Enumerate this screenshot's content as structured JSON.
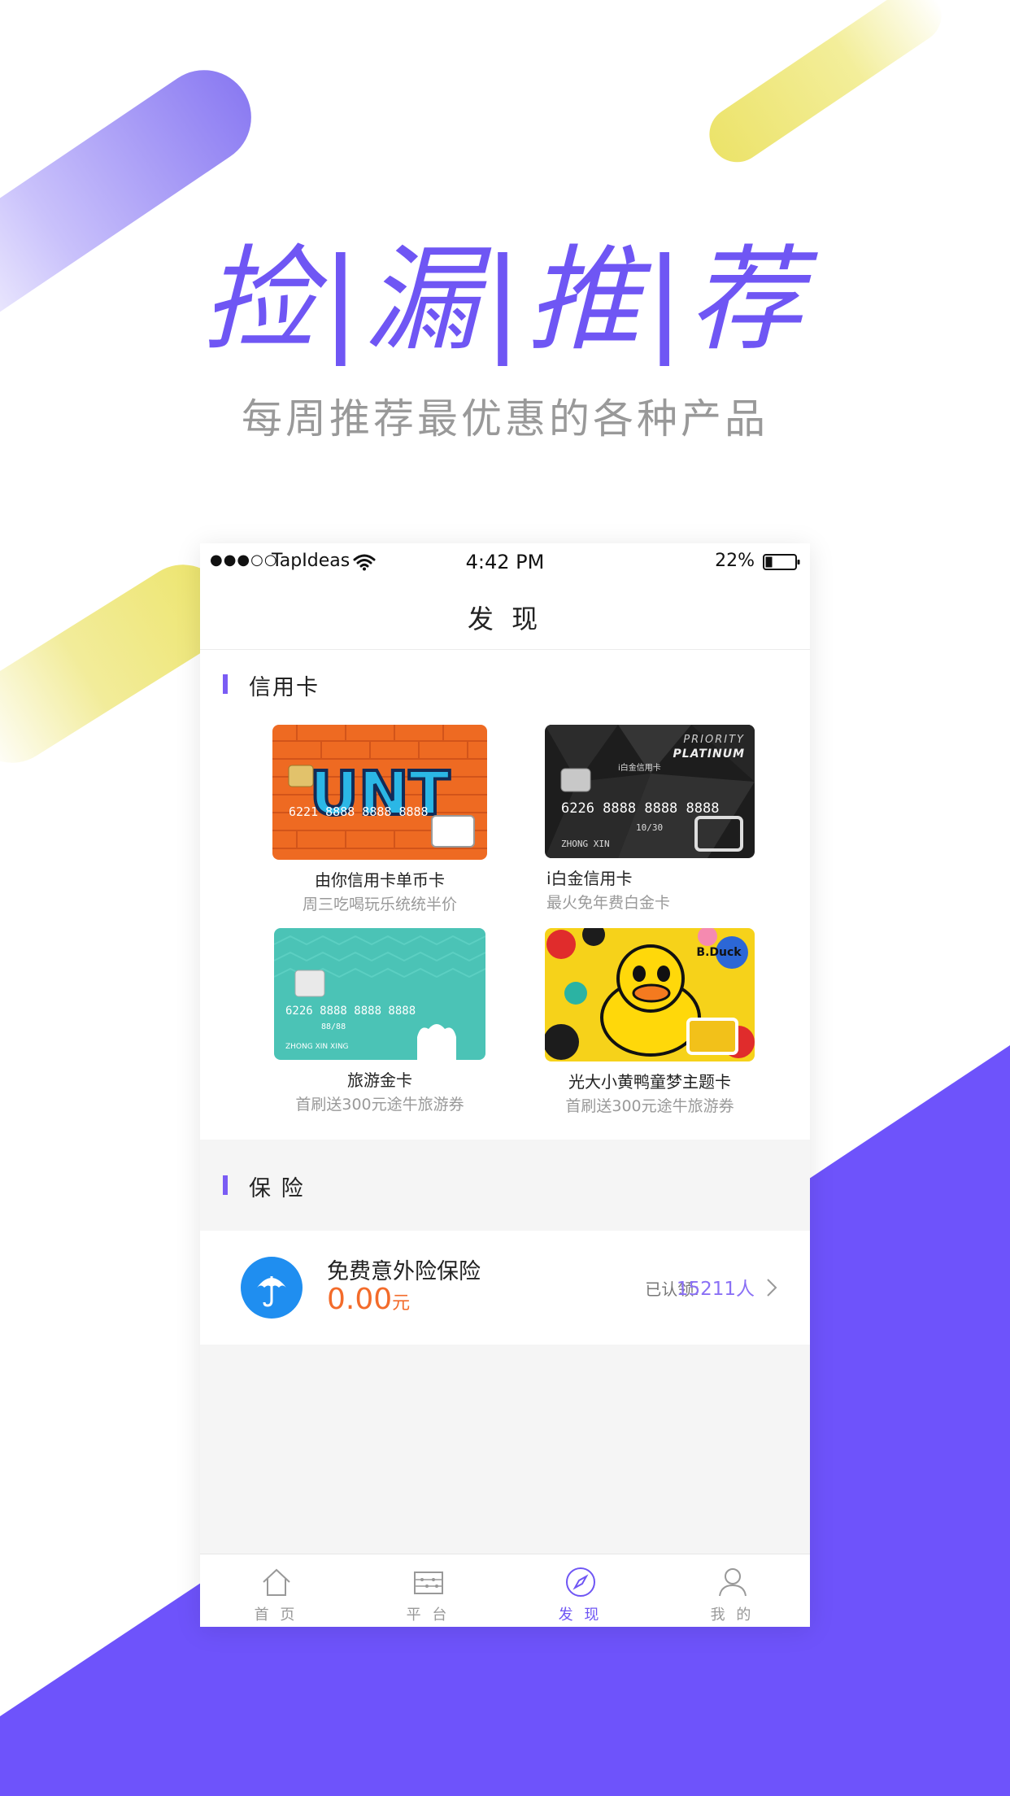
{
  "headline": {
    "title": "捡|漏|推|荐",
    "subtitle": "每周推荐最优惠的各种产品"
  },
  "status_bar": {
    "signal": "●●●○○",
    "carrier": "TapIdeas",
    "time": "4:42 PM",
    "battery": "22%"
  },
  "nav": {
    "title": "发 现"
  },
  "credit_cards": {
    "section_title": "信用卡",
    "cards": [
      {
        "name": "由你信用卡单币卡",
        "desc": "周三吃喝玩乐统统半价"
      },
      {
        "name": "i白金信用卡",
        "desc": "最火免年费白金卡"
      },
      {
        "name": "旅游金卡",
        "desc": "首刷送300元途牛旅游券"
      },
      {
        "name": "光大小黄鸭童梦主题卡",
        "desc": "首刷送300元途牛旅游券"
      }
    ],
    "card_art": {
      "unt_text": "UNT",
      "unt_number": "6221 8888 8888 8888",
      "platinum_brand": "PRIORITY",
      "platinum_sub": "PLATINUM",
      "platinum_label": "i白金信用卡",
      "platinum_number": "6226 8888 8888 8888",
      "platinum_holder": "ZHONG XIN",
      "platinum_expiry": "10/30",
      "travel_number": "6226 8888 8888 8888",
      "travel_expiry": "88/88",
      "travel_holder": "ZHONG XIN XING",
      "duck_brand": "B.Duck"
    }
  },
  "insurance": {
    "section_title": "保 险",
    "item": {
      "name": "免费意外险保险",
      "price": "0.00",
      "unit": "元",
      "claim_label": "已认领:",
      "claim_value": "15211人"
    }
  },
  "tabs": [
    {
      "label": "首 页",
      "icon": "home-icon"
    },
    {
      "label": "平 台",
      "icon": "abacus-icon"
    },
    {
      "label": "发 现",
      "icon": "compass-icon"
    },
    {
      "label": "我 的",
      "icon": "user-icon"
    }
  ],
  "colors": {
    "brand_purple": "#6f56f4",
    "background_purple": "#6e53fb",
    "accent_yellow": "#ede56e",
    "price_orange": "#f36b2a",
    "insurance_blue": "#1f8ef0"
  }
}
